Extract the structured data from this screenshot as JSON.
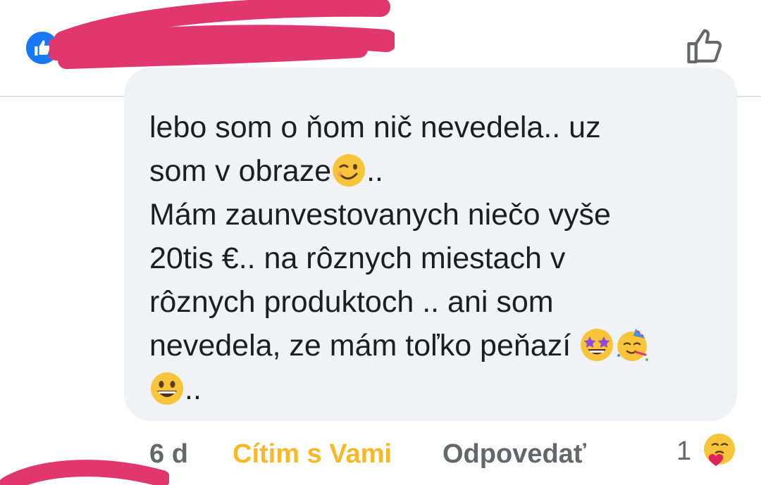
{
  "header": {
    "badge_icon": "like-thumb-icon",
    "like_button_icon": "thumbs-up-outline-icon"
  },
  "comment": {
    "lines": [
      {
        "text": "lebo som o ňom nič nevedela.. uz"
      },
      {
        "text_before": "som v obraze",
        "emoji": "winking-face",
        "text_after": ".."
      },
      {
        "text": "Mám zaunvestovanych niečo vyše"
      },
      {
        "text": "20tis €.. na rôznych miestach v"
      },
      {
        "text": "rôznych produktoch .. ani som"
      },
      {
        "text_before": "nevedela, ze mám toľko peňazí ",
        "emojis": [
          "star-struck",
          "partying-face"
        ]
      },
      {
        "emoji": "grinning-face",
        "text_after": ".."
      }
    ]
  },
  "actions": {
    "time": "6 d",
    "react_label": "Cítim s Vami",
    "reply_label": "Odpovedať",
    "reaction_count": "1",
    "reaction_icon": "care-reaction-icon"
  },
  "colors": {
    "bubble": "#f0f2f5",
    "react_label": "#f7b928",
    "secondary_text": "#65676b",
    "redaction": "#e0376f",
    "like_blue": "#1877f2"
  }
}
